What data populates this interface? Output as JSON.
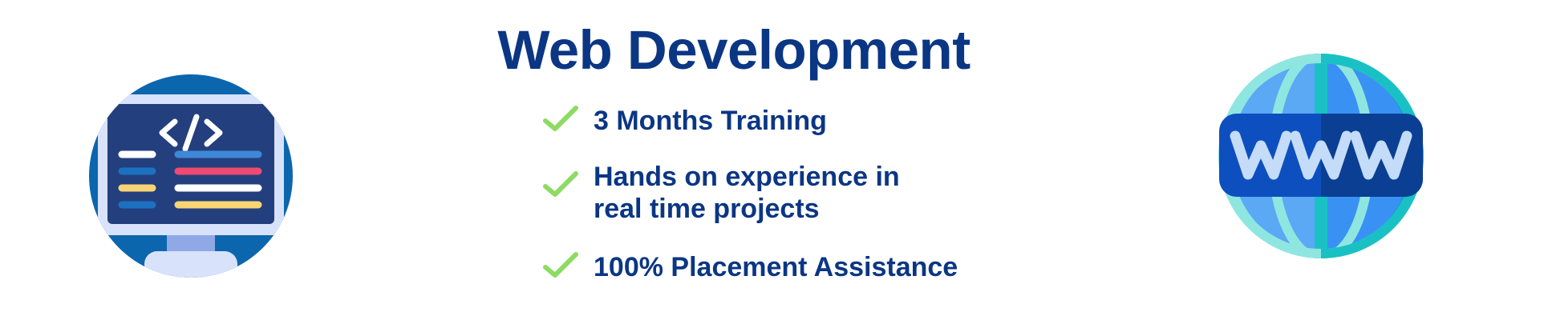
{
  "header": {
    "title": "Web Development"
  },
  "features": [
    {
      "icon": "check-icon",
      "text": "3 Months Training"
    },
    {
      "icon": "check-icon",
      "text": "Hands on experience in real time projects"
    },
    {
      "icon": "check-icon",
      "text": "100% Placement Assistance"
    }
  ],
  "illustrations": {
    "left": "code-monitor-icon",
    "right": "www-globe-icon"
  },
  "colors": {
    "title": "#0b3684",
    "check": "#8ddb63"
  }
}
